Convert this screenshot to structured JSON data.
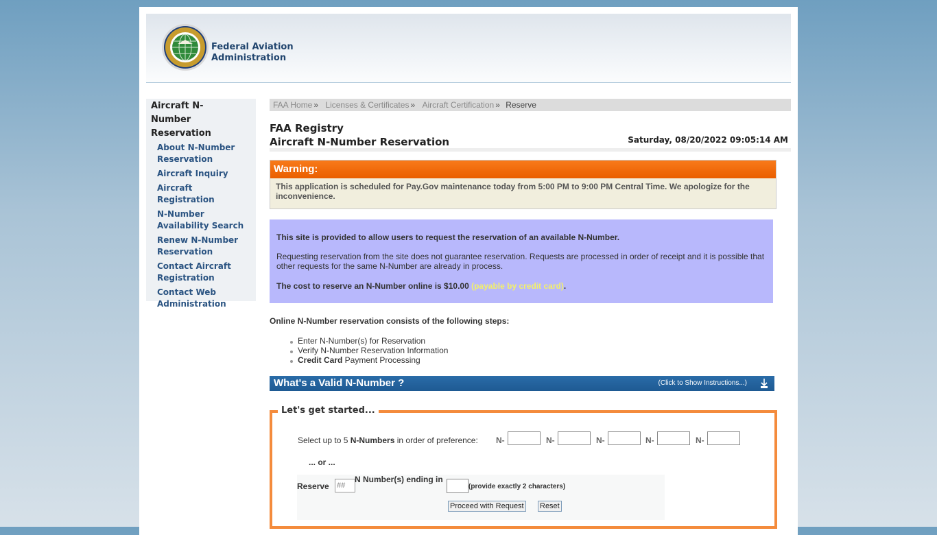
{
  "header": {
    "brand_line1": "Federal Aviation",
    "brand_line2": "Administration",
    "seal_icon": "faa-seal-icon"
  },
  "sidebar": {
    "title": "Aircraft N-Number Reservation",
    "items": [
      {
        "label": "About N-Number Reservation"
      },
      {
        "label": "Aircraft Inquiry"
      },
      {
        "label": "Aircraft Registration"
      },
      {
        "label": "N-Number Availability Search"
      },
      {
        "label": "Renew N-Number Reservation"
      },
      {
        "label": "Contact Aircraft Registration"
      },
      {
        "label": "Contact Web Administration"
      }
    ]
  },
  "breadcrumb": {
    "items": [
      "FAA Home",
      "Licenses & Certificates",
      "Aircraft Certification"
    ],
    "separator": "»",
    "current": "Reserve"
  },
  "titles": {
    "line1": "FAA Registry",
    "line2": "Aircraft N-Number Reservation",
    "datetime": "Saturday, 08/20/2022 09:05:14 AM"
  },
  "warning": {
    "title": "Warning:",
    "message": "This application is scheduled for Pay.Gov maintenance today from 5:00 PM to 9:00 PM Central Time. We apologize for the inconvenience."
  },
  "info": {
    "p1": "This site is provided to allow users to request the reservation of an available N-Number.",
    "p2": "Requesting reservation from the site does not guarantee reservation. Requests are processed in order of receipt and it is possible that other requests for the same N-Number are already in process.",
    "p3_prefix": "The cost to reserve an N-Number online is $10.00 ",
    "p3_link": "(payable by credit card)",
    "p3_suffix": "."
  },
  "steps": {
    "intro": "Online N-Number reservation consists of the following steps:",
    "items": [
      {
        "bold": "",
        "text": "Enter N-Number(s) for Reservation"
      },
      {
        "bold": "",
        "text": "Verify N-Number Reservation Information"
      },
      {
        "bold": "Credit Card",
        "text": " Payment Processing"
      }
    ]
  },
  "valid_bar": {
    "title": "What's a Valid N-Number ?",
    "hint": "(Click to Show Instructions...)"
  },
  "form": {
    "legend": "Let's get started...",
    "select_prefix": "Select up to 5 ",
    "select_bold": "N-Numbers",
    "select_suffix": " in order of preference:",
    "n_prefix": "N-",
    "n_inputs": [
      "",
      "",
      "",
      "",
      ""
    ],
    "or_text": "... or ...",
    "reserve_label": "Reserve",
    "count_placeholder": "##",
    "ending_label": "N Number(s) ending in",
    "ending_value": "",
    "ending_hint": "(provide exactly 2 characters)",
    "proceed_label": "Proceed with Request",
    "reset_label": "Reset"
  },
  "colors": {
    "warning_header": "#ea5e00",
    "info_bg": "#b8b8fc",
    "valid_bar": "#1e5a93",
    "form_border": "#f48b3c",
    "link_yellow": "#f3f06a"
  }
}
